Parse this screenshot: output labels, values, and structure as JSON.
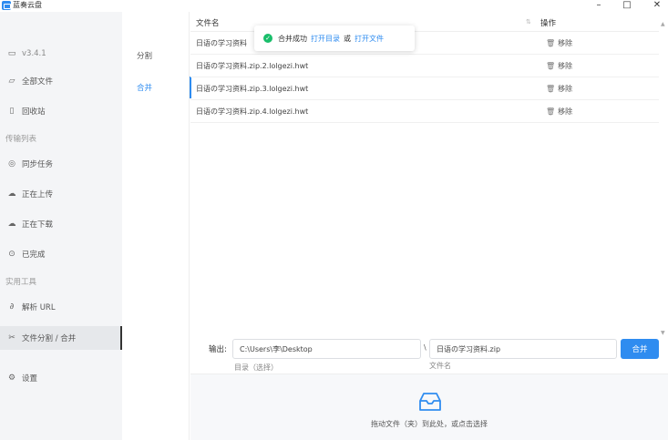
{
  "window": {
    "title": "蓝奏云盘",
    "minimize": "–",
    "maximize": "□",
    "close": "✕"
  },
  "sidebar": {
    "version": "v3.4.1",
    "items": [
      {
        "label": "全部文件",
        "icon": "folder-icon"
      },
      {
        "label": "回收站",
        "icon": "trash-icon"
      }
    ],
    "transfer_section": "传输列表",
    "transfer_items": [
      {
        "label": "同步任务",
        "icon": "sync-icon"
      },
      {
        "label": "正在上传",
        "icon": "upload-icon"
      },
      {
        "label": "正在下载",
        "icon": "download-icon"
      },
      {
        "label": "已完成",
        "icon": "check-circle-icon"
      }
    ],
    "tools_section": "实用工具",
    "tool_items": [
      {
        "label": "解析 URL",
        "icon": "link-icon"
      },
      {
        "label": "文件分割 / 合并",
        "icon": "scissors-icon",
        "active": true
      }
    ],
    "settings": {
      "label": "设置",
      "icon": "gear-icon"
    }
  },
  "subnav": {
    "split": "分割",
    "merge": "合并",
    "active": "merge"
  },
  "table": {
    "col_name": "文件名",
    "col_action": "操作",
    "rows": [
      {
        "name": "日语の学习资料.zip.1.lolgezi.hwt",
        "action": "移除"
      },
      {
        "name": "日语の学习资料.zip.2.lolgezi.hwt",
        "action": "移除"
      },
      {
        "name": "日语の学习资料.zip.3.lolgezi.hwt",
        "action": "移除"
      },
      {
        "name": "日语の学习资料.zip.4.lolgezi.hwt",
        "action": "移除"
      }
    ],
    "visible_row1_prefix": "日语の学习资料"
  },
  "toast": {
    "message": "合并成功",
    "open_dir": "打开目录",
    "or": "或",
    "open_file": "打开文件"
  },
  "output": {
    "label": "输出:",
    "dir_value": "C:\\Users\\李\\Desktop",
    "dir_hint": "目录（选择）",
    "separator": "\\",
    "name_value": "日语の学习资料.zip",
    "name_hint": "文件名",
    "merge_button": "合并"
  },
  "dropzone": {
    "text": "拖动文件（夹）到此处，或点击选择"
  },
  "colors": {
    "accent": "#2f8cf0",
    "success": "#19be6b",
    "sidebar_bg": "#f4f5f7"
  }
}
